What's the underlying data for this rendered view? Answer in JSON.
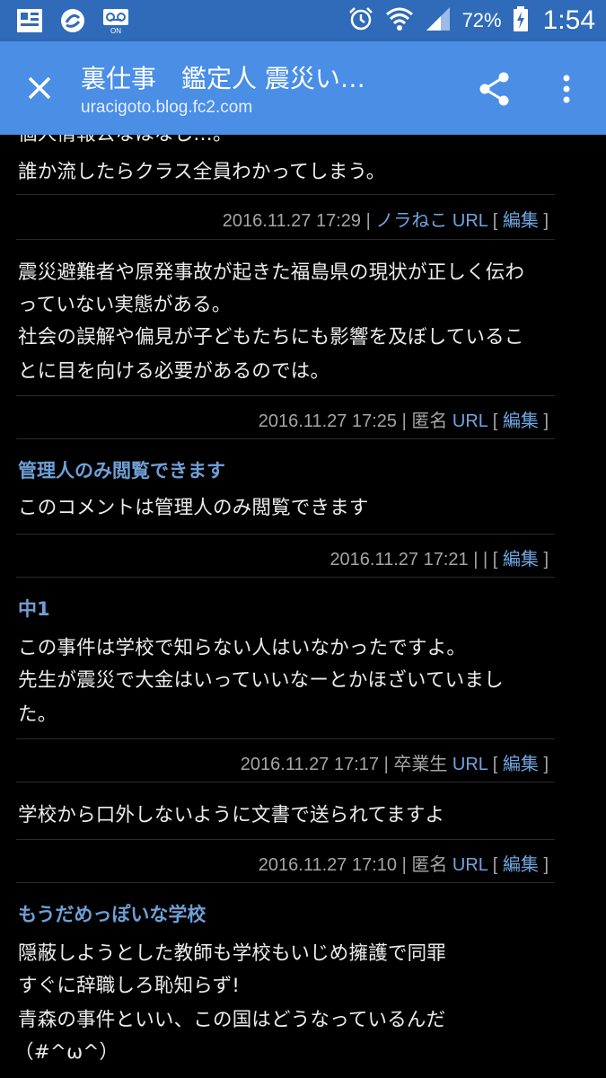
{
  "status_bar": {
    "battery_percent": "72%",
    "time": "1:54",
    "icons": [
      "notification-icon",
      "sync-icon",
      "voicemail-on-icon",
      "alarm-icon",
      "wifi-icon",
      "signal-icon",
      "battery-charging-icon"
    ]
  },
  "toolbar": {
    "title": "裏仕事　鑑定人 震災い…",
    "url": "uracigoto.blog.fc2.com"
  },
  "comments": [
    {
      "title": "",
      "body": [
        "個人情報公なはなし…。",
        "誰か流したらクラス全員わかってしまう。"
      ],
      "meta": {
        "datetime": "2016.11.27 17:29",
        "sep": "|",
        "name": "ノラねこ",
        "url_label": "URL",
        "edit_label": "編集"
      }
    },
    {
      "title": "",
      "body": [
        "震災避難者や原発事故が起きた福島県の現状が正しく伝わ",
        "っていない実態がある。",
        "社会の誤解や偏見が子どもたちにも影響を及ぼしているこ",
        "とに目を向ける必要があるのでは。"
      ],
      "meta": {
        "datetime": "2016.11.27 17:25",
        "sep": "|",
        "name": "匿名",
        "url_label": "URL",
        "edit_label": "編集"
      }
    },
    {
      "title": "管理人のみ閲覧できます",
      "body": [
        "このコメントは管理人のみ閲覧できます"
      ],
      "meta": {
        "datetime": "2016.11.27 17:21",
        "sep": "|",
        "name": "",
        "url_label": "|",
        "edit_label": "編集"
      }
    },
    {
      "title": "中1",
      "body": [
        "この事件は学校で知らない人はいなかったですよ。",
        "先生が震災で大金はいっていいなーとかほざいていまし",
        "た。"
      ],
      "meta": {
        "datetime": "2016.11.27 17:17",
        "sep": "|",
        "name": "卒業生",
        "url_label": "URL",
        "edit_label": "編集"
      }
    },
    {
      "title": "",
      "body": [
        "学校から口外しないように文書で送られてますよ"
      ],
      "meta": {
        "datetime": "2016.11.27 17:10",
        "sep": "|",
        "name": "匿名",
        "url_label": "URL",
        "edit_label": "編集"
      }
    },
    {
      "title": "もうだめっぽいな学校",
      "body": [
        "隠蔽しようとした教師も学校もいじめ擁護で同罪",
        "すぐに辞職しろ恥知らず!",
        "青森の事件といい、この国はどうなっているんだ",
        "（#^ω^）"
      ],
      "meta": null
    }
  ]
}
